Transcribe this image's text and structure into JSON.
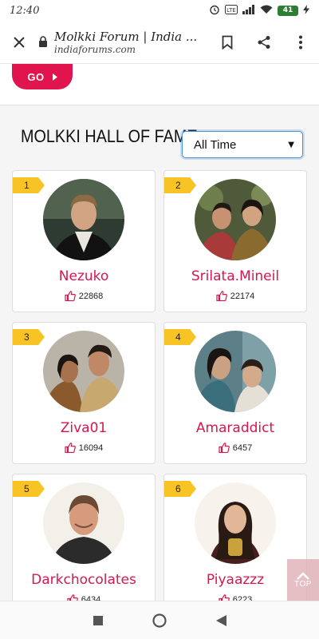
{
  "status_bar": {
    "time": "12:40",
    "network_label": "Vo LTE",
    "battery_level": "41"
  },
  "browser": {
    "page_title": "Molkki Forum | India ...",
    "host": "indiaforums.com",
    "icons": [
      "close-icon",
      "lock-icon",
      "bookmark-icon",
      "share-icon",
      "more-vert-icon"
    ]
  },
  "go_button": {
    "label": "GO",
    "icon": "chevron-right-icon"
  },
  "hall_of_fame": {
    "title": "MOLKKI HALL OF FAME",
    "period": {
      "selected": "All Time"
    },
    "members": [
      {
        "rank": "1",
        "name": "Nezuko",
        "likes": "22868"
      },
      {
        "rank": "2",
        "name": "Srilata.Mineil",
        "likes": "22174"
      },
      {
        "rank": "3",
        "name": "Ziva01",
        "likes": "16094"
      },
      {
        "rank": "4",
        "name": "Amaraddict",
        "likes": "6457"
      },
      {
        "rank": "5",
        "name": "Darkchocolates",
        "likes": "6434"
      },
      {
        "rank": "6",
        "name": "Piyaazzz",
        "likes": "6223"
      }
    ]
  },
  "back_to_top": {
    "label": "TOP"
  },
  "colors": {
    "accent": "#e0154e",
    "name": "#d6174f",
    "rank_badge": "#f7c325"
  }
}
